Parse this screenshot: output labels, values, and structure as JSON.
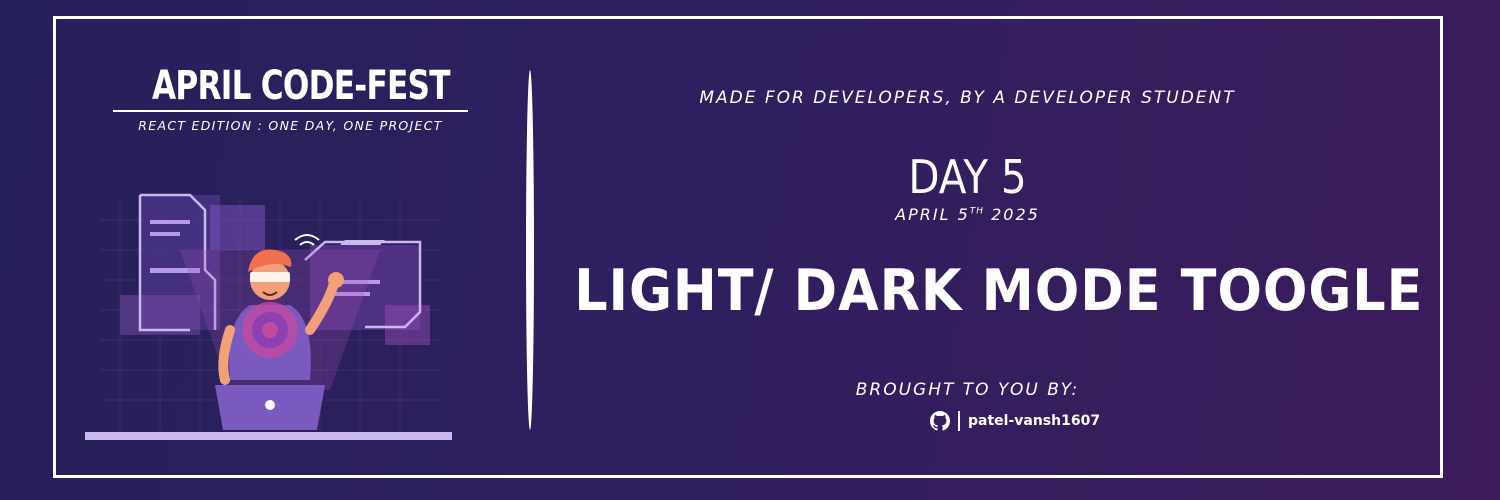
{
  "event": {
    "title": "APRIL CODE-FEST",
    "subtitle": "REACT EDITION : ONE DAY, ONE PROJECT"
  },
  "tagline": "MADE FOR DEVELOPERS, BY A DEVELOPER STUDENT",
  "day": "DAY 5",
  "date": {
    "prefix": "APRIL 5",
    "suffix": "TH",
    "year": "2025"
  },
  "project_title": "LIGHT/ DARK MODE TOOGLE",
  "credits": {
    "label": "BROUGHT TO YOU BY:",
    "username": "patel-vansh1607",
    "icon": "github-icon"
  },
  "colors": {
    "background_start": "#26205a",
    "background_end": "#3c1c5c",
    "foreground": "#ffffff",
    "accent_purple": "#8a5cc9",
    "accent_orange": "#f2704e"
  }
}
